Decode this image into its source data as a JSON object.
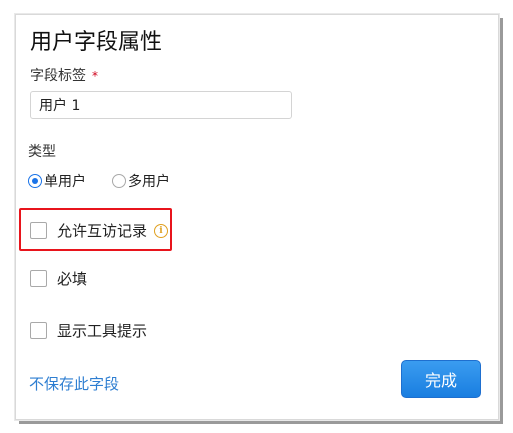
{
  "dialog": {
    "title": "用户字段属性"
  },
  "field_label": {
    "label": "字段标签",
    "required_mark": "*",
    "value": "用户 1"
  },
  "type": {
    "label": "类型",
    "options": [
      {
        "label": "单用户",
        "selected": true
      },
      {
        "label": "多用户",
        "selected": false
      }
    ]
  },
  "options": {
    "allow_access_records": {
      "label": "允许互访记录",
      "checked": false,
      "icon": "info-icon"
    },
    "required": {
      "label": "必填",
      "checked": false
    },
    "show_tooltip": {
      "label": "显示工具提示",
      "checked": false
    }
  },
  "footer": {
    "discard_label": "不保存此字段",
    "done_label": "完成"
  },
  "colors": {
    "accent": "#1a7ee0",
    "link": "#2e7ed1",
    "highlight": "#e8141c",
    "required": "#d0021b",
    "info_icon": "#e0a020"
  }
}
